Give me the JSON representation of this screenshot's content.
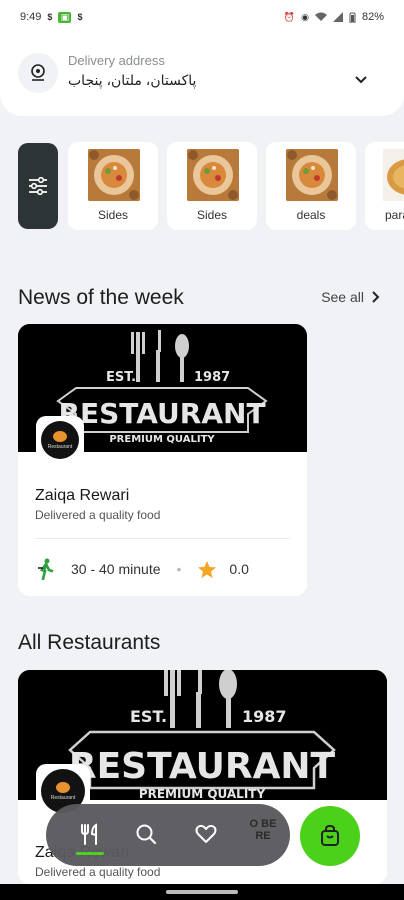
{
  "status_bar": {
    "time": "9:49",
    "battery": "82%"
  },
  "address": {
    "label": "Delivery address",
    "value": "پاکستان، ملتان، پنجاب"
  },
  "categories": [
    {
      "label": "Sides"
    },
    {
      "label": "Sides"
    },
    {
      "label": "deals"
    },
    {
      "label": "paratha"
    }
  ],
  "news_section": {
    "title": "News of the week",
    "see_all": "See all"
  },
  "featured_restaurant": {
    "banner_est": "EST.",
    "banner_year": "1987",
    "banner_word": "RESTAURANT",
    "banner_tag": "PREMIUM QUALITY",
    "logo_text": "Restaurant",
    "name": "Zaiqa Rewari",
    "subtitle": "Delivered a quality food",
    "delivery_time": "30 - 40 minute",
    "rating": "0.0"
  },
  "all_section": {
    "title": "All Restaurants"
  },
  "all_restaurant": {
    "banner_est": "EST.",
    "banner_year": "1987",
    "banner_word": "RESTAURANT",
    "banner_tag": "PREMIUM QUALITY",
    "logo_text": "Restaurant",
    "name": "Zaiqa Rewari",
    "subtitle": "Delivered a quality food"
  },
  "bottom_nav": {
    "more_text": "O BE RE"
  },
  "colors": {
    "accent_green": "#4cd11b",
    "dark_button": "#2d3436",
    "background": "#f1f2f6"
  },
  "icons": [
    "location-pin-icon",
    "chevron-down-icon",
    "sliders-icon",
    "chevron-right-icon",
    "walking-person-icon",
    "star-icon",
    "fork-knife-icon",
    "search-icon",
    "heart-icon",
    "shopping-bag-icon"
  ]
}
